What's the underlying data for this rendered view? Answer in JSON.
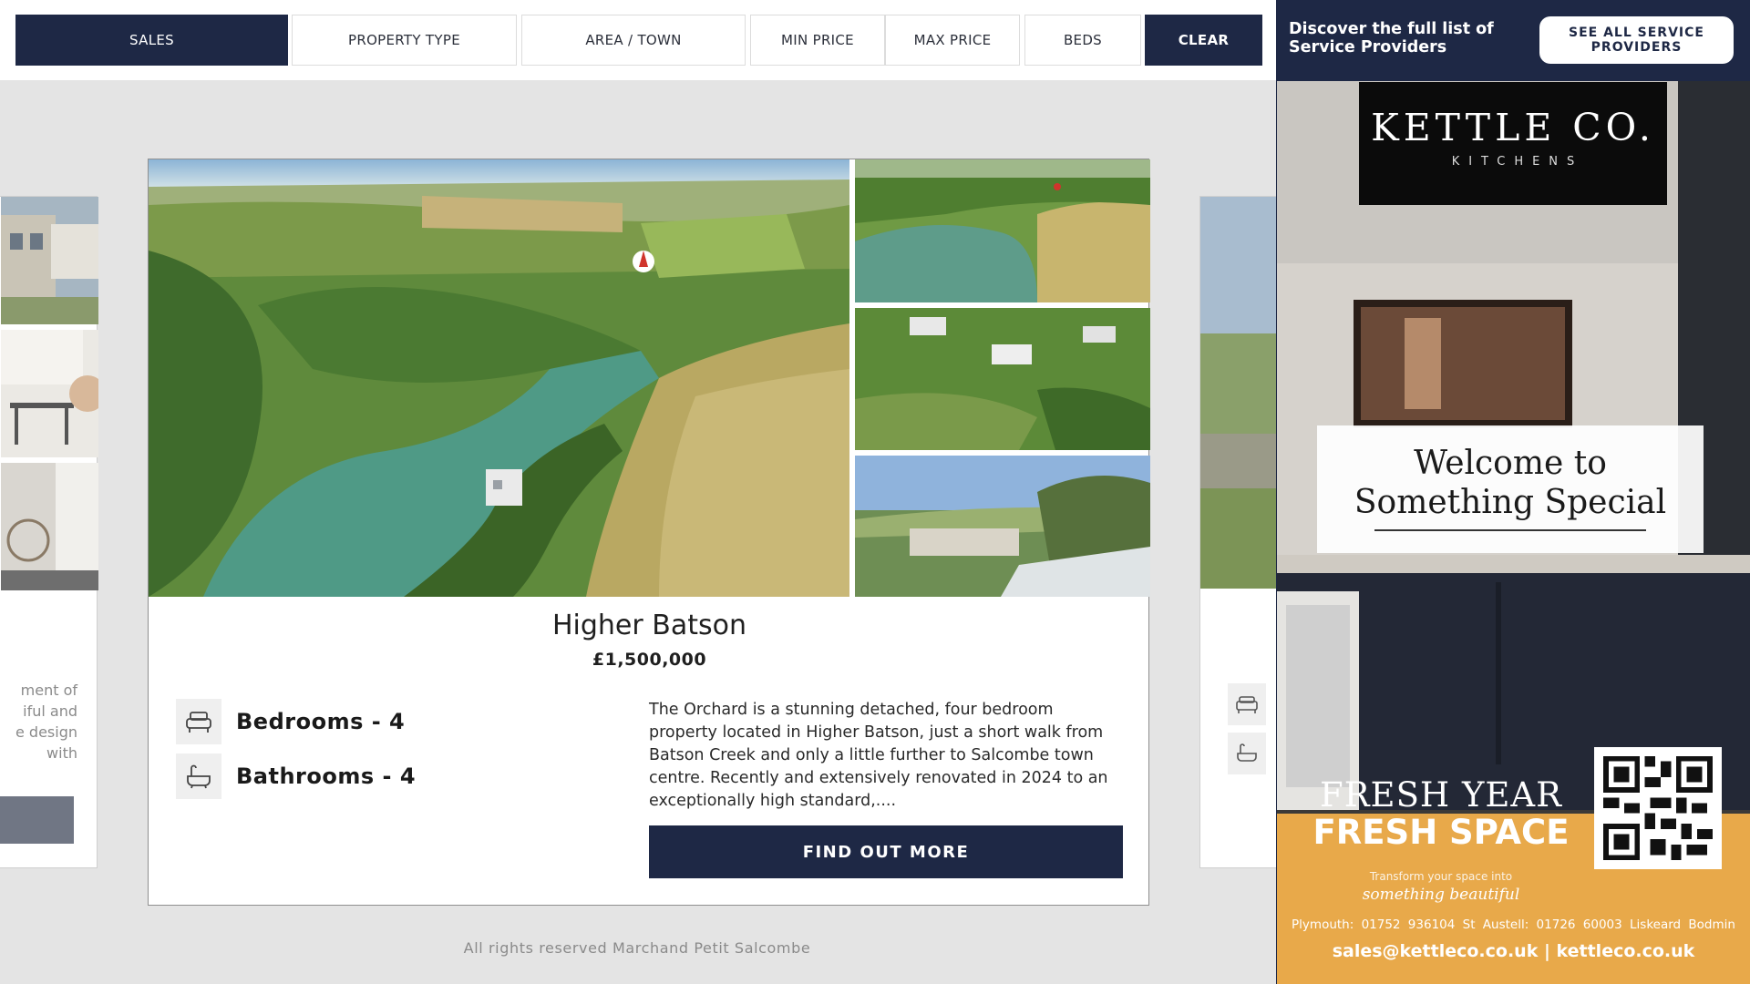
{
  "filters": {
    "sales": "SALES",
    "property_type": "PROPERTY TYPE",
    "area_town": "AREA / TOWN",
    "min_price": "MIN PRICE",
    "max_price": "MAX PRICE",
    "beds": "BEDS",
    "clear": "CLEAR"
  },
  "ghost_left": {
    "text_lines": [
      "ment of",
      "iful and",
      "e design",
      " with"
    ]
  },
  "property": {
    "title": "Higher Batson",
    "price": "£1,500,000",
    "bedrooms": "Bedrooms - 4",
    "bathrooms": "Bathrooms - 4",
    "description": "The Orchard is a stunning detached, four bedroom property located in Higher Batson, just a short walk from Batson Creek and only a little further to Salcombe town centre. Recently and extensively renovated in 2024 to an exceptionally high standard,....",
    "cta": "FIND OUT MORE"
  },
  "footer": "All rights reserved Marchand Petit Salcombe",
  "ad": {
    "discover": "Discover the full list of Service Providers",
    "see_all": "SEE ALL SERVICE PROVIDERS",
    "brand": "KETTLE CO.",
    "brand_sub": "KITCHENS",
    "welcome_line1": "Welcome to",
    "welcome_line2": "Something Special",
    "headline1": "FRESH YEAR",
    "headline2": "FRESH SPACE",
    "transform": "Transform your space into",
    "beautiful": "something beautiful",
    "phones": "Plymouth: 01752 936104   St Austell: 01726 60003   Liskeard   Bodmin",
    "contact": "sales@kettleco.co.uk | kettleco.co.uk"
  },
  "colors": {
    "navy": "#1e2845",
    "ad_orange": "#e8a94a",
    "background": "#e4e4e4"
  }
}
